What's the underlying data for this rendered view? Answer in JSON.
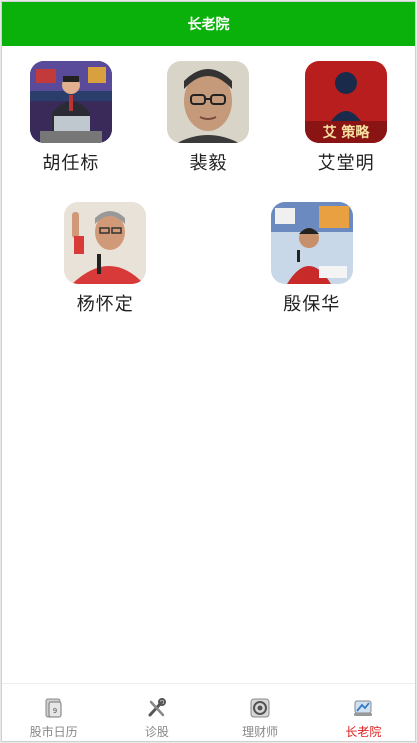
{
  "header": {
    "title": "长老院"
  },
  "people_row1": [
    {
      "name": "胡任标",
      "icon": "anchor-at-desk-photo"
    },
    {
      "name": "裴毅",
      "icon": "man-with-glasses-photo"
    },
    {
      "name": "艾堂明",
      "icon": "red-strategy-poster-photo"
    }
  ],
  "people_row2": [
    {
      "name": "杨怀定",
      "icon": "man-pointing-finger-photo"
    },
    {
      "name": "殷保华",
      "icon": "man-at-booth-photo"
    }
  ],
  "avatar_poster_text": "艾 策略",
  "tabs": [
    {
      "label": "股市日历",
      "icon": "calendar-icon",
      "active": false
    },
    {
      "label": "诊股",
      "icon": "tools-icon",
      "active": false
    },
    {
      "label": "理财师",
      "icon": "advisor-icon",
      "active": false
    },
    {
      "label": "长老院",
      "icon": "elders-icon",
      "active": true
    }
  ],
  "colors": {
    "header_bg": "#0ab10a",
    "active_tab": "#e02020",
    "inactive_tab": "#888888"
  }
}
